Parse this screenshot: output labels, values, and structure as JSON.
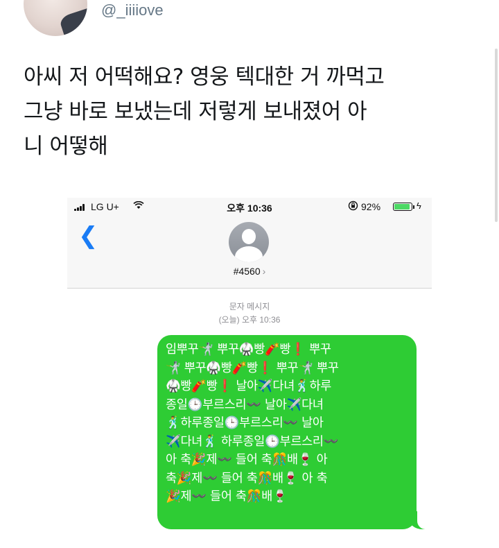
{
  "tweet": {
    "handle": "@_iiiiove",
    "text_lines": [
      "아씨 저 어떡해요? 영웅 텍대한 거 까먹고",
      "그냥 바로 보냈는데 저렇게 보내졌어 아",
      "니 어떻해"
    ]
  },
  "phone": {
    "status_bar": {
      "carrier": "LG U+",
      "time": "오후 10:36",
      "battery": "92%",
      "battery_level": 0.92
    },
    "back_glyph": "❮",
    "contact_number": "#4560",
    "contact_chevron": "›",
    "message_type": "문자 메시지",
    "timestamp": "(오늘) 오후 10:36",
    "message_lines": [
      "임뿌꾸🤺 뿌꾸🥋빵🧨빵❗ 뿌꾸",
      "🤺 뿌꾸🥋빵🧨빵❗ 뿌꾸🤺 뿌꾸",
      "🥋빵🧨빵❗ 날아✈️다녀🕺하루",
      "종일🕒부르스리〰️ 날아✈️다녀",
      "🕺하루종일🕒부르스리〰️ 날아",
      "✈️다녀🕺 하루종일🕒부르스리〰️",
      "아 축🎉제〰️ 들어 축🎊배🍷 아",
      "축🎉제〰️ 들어 축🎊배🍷 아 축",
      "🎉제〰️ 들어 축🎊배🍷"
    ]
  },
  "colors": {
    "bubble": "#2ecc34",
    "accent_blue": "#1a7cf5",
    "handle_gray": "#657786"
  }
}
